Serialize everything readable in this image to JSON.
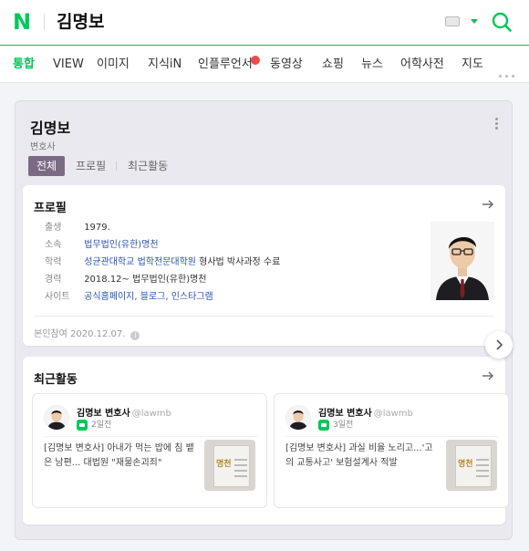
{
  "header": {
    "logo": "N",
    "query": "김명보",
    "keyboard_icon": "keyboard-icon",
    "dropdown_icon": "caret-down-icon",
    "search_icon": "search-icon",
    "accent_color": "#03c75a"
  },
  "tabs": [
    {
      "label": "통합",
      "active": true
    },
    {
      "label": "VIEW"
    },
    {
      "label": "이미지"
    },
    {
      "label": "지식iN"
    },
    {
      "label": "인플루언서",
      "badge": true
    },
    {
      "label": "동영상"
    },
    {
      "label": "쇼핑"
    },
    {
      "label": "뉴스"
    },
    {
      "label": "어학사전"
    },
    {
      "label": "지도"
    }
  ],
  "profile_panel": {
    "name": "김명보",
    "job": "변호사",
    "segments": [
      "전체",
      "프로필",
      "최근활동"
    ],
    "segment_color": "#7a6a86"
  },
  "profile_card": {
    "title": "프로필",
    "rows": [
      {
        "label": "출생",
        "value": "1979."
      },
      {
        "label": "소속",
        "value": "법무법인(유한)명천",
        "link": true
      },
      {
        "label": "학력",
        "value_link": "성균관대학교 법학전문대학원",
        "value_rest": " 형사법 박사과정 수료"
      },
      {
        "label": "경력",
        "value": "2018.12~ 법무법인(유한)명천"
      },
      {
        "label": "사이트",
        "value": "공식홈페이지, 블로그, 인스타그램",
        "link": true
      }
    ],
    "verified_text": "본인참여 2020.12.07.",
    "info_icon": "info-icon",
    "link_color": "#2b54b5"
  },
  "recent_card": {
    "title": "최근활동",
    "posts": [
      {
        "author": "김명보 변호사",
        "handle": "@lawmb",
        "time": "2일전",
        "text": "[김명보 변호사] 아내가 먹는 밥에 침 뱉은 남편... 대법원 \"재물손괴죄\"",
        "thumb_text": "명천"
      },
      {
        "author": "김명보 변호사",
        "handle": "@lawmb",
        "time": "3일전",
        "text": "[김명보 변호사] 과실 비율 노리고...'고의 교통사고' 보험설계사 적발",
        "thumb_text": "명천"
      }
    ]
  }
}
